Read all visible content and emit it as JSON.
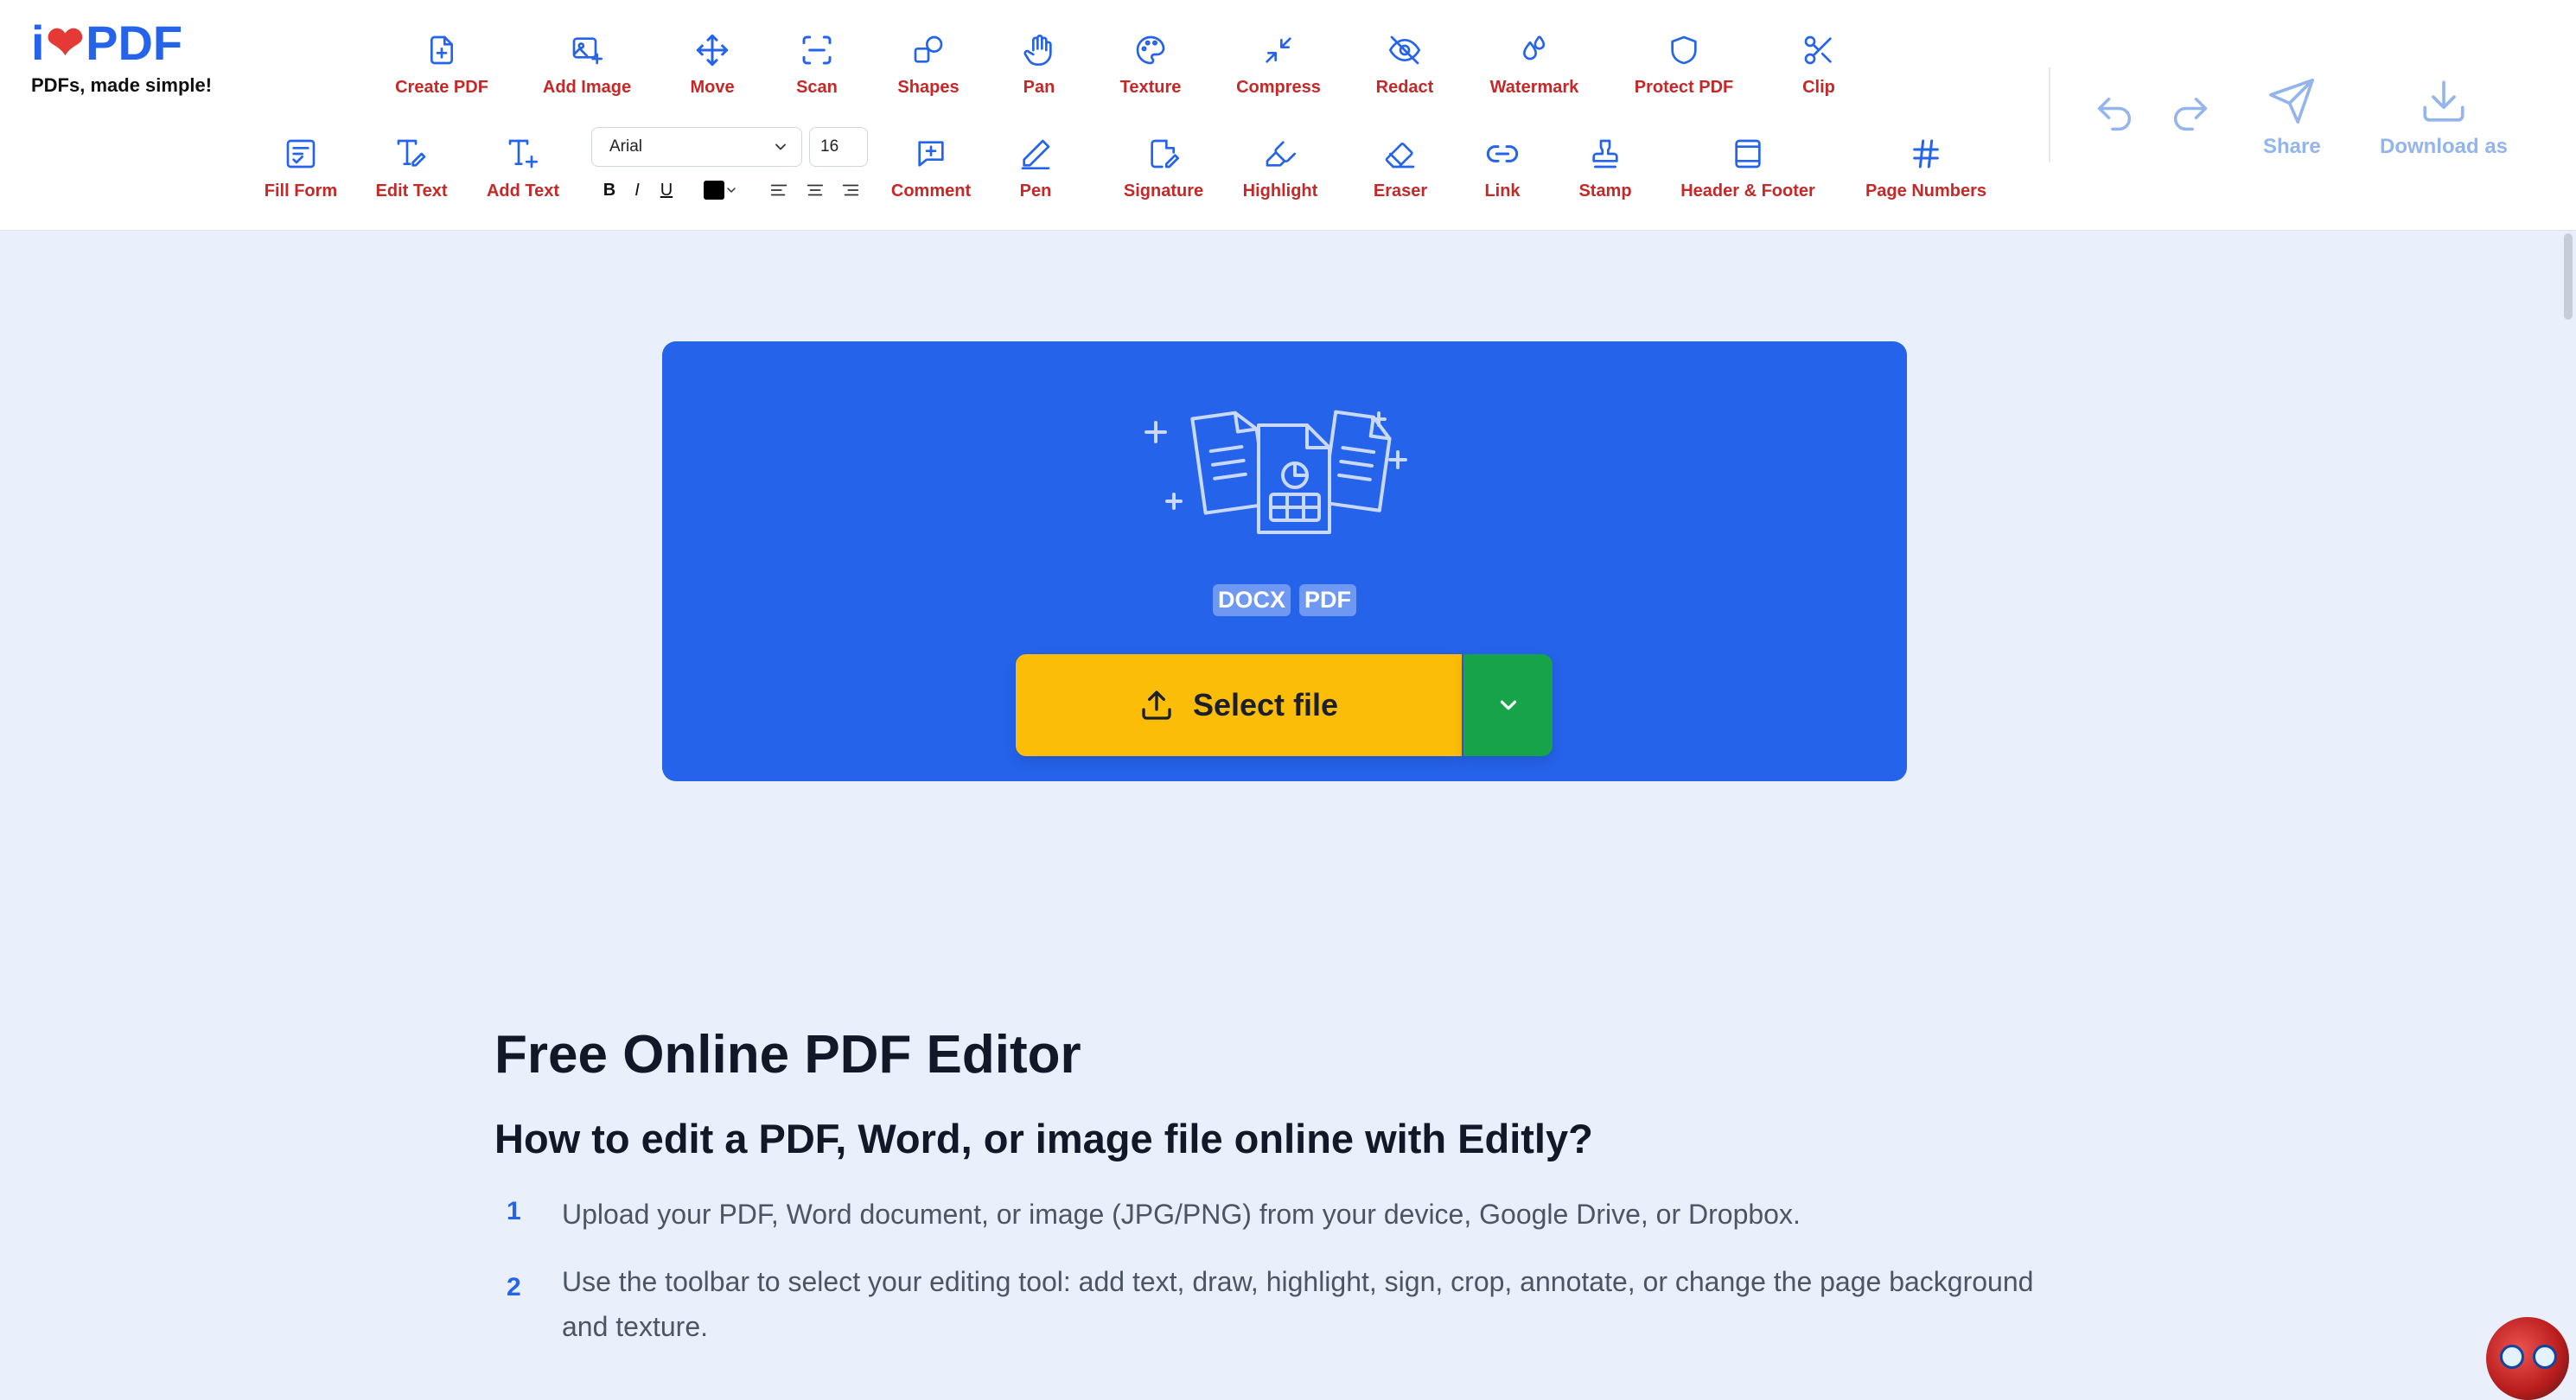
{
  "logo": {
    "prefix": "i",
    "suffix": "PDF",
    "tagline": "PDFs, made simple!"
  },
  "toolbar": {
    "row1": [
      {
        "label": "Create PDF",
        "icon": "file-plus-icon"
      },
      {
        "label": "Add Image",
        "icon": "image-plus-icon"
      },
      {
        "label": "Move",
        "icon": "move-arrows-icon"
      },
      {
        "label": "Scan",
        "icon": "scan-icon"
      },
      {
        "label": "Shapes",
        "icon": "shapes-icon"
      },
      {
        "label": "Pan",
        "icon": "hand-icon"
      },
      {
        "label": "Texture",
        "icon": "palette-icon"
      },
      {
        "label": "Compress",
        "icon": "compress-icon"
      },
      {
        "label": "Redact",
        "icon": "eye-off-icon"
      },
      {
        "label": "Watermark",
        "icon": "droplets-icon"
      },
      {
        "label": "Protect PDF",
        "icon": "shield-icon"
      },
      {
        "label": "Clip",
        "icon": "scissors-icon"
      }
    ],
    "row2": [
      {
        "label": "Fill Form",
        "icon": "form-icon"
      },
      {
        "label": "Edit Text",
        "icon": "edit-text-icon"
      },
      {
        "label": "Add Text",
        "icon": "add-text-icon"
      },
      {
        "label": "Comment",
        "icon": "comment-icon"
      },
      {
        "label": "Pen",
        "icon": "pen-icon"
      },
      {
        "label": "Signature",
        "icon": "signature-icon"
      },
      {
        "label": "Highlight",
        "icon": "highlighter-icon"
      },
      {
        "label": "Eraser",
        "icon": "eraser-icon"
      },
      {
        "label": "Link",
        "icon": "link-icon"
      },
      {
        "label": "Stamp",
        "icon": "stamp-icon"
      },
      {
        "label": "Header & Footer",
        "icon": "header-footer-icon"
      },
      {
        "label": "Page Numbers",
        "icon": "hash-icon"
      }
    ],
    "font": {
      "family": "Arial",
      "size": "16"
    },
    "format": {
      "bold": "B",
      "italic": "I",
      "underline": "U",
      "color": "#000000"
    },
    "right": {
      "share": "Share",
      "download": "Download as"
    }
  },
  "hero": {
    "badges": [
      "DOCX",
      "PDF"
    ],
    "select_label": "Select file",
    "bg_color": "#2563eb",
    "button_color": "#fbbd08",
    "dropdown_color": "#16a34a"
  },
  "content": {
    "title": "Free Online PDF Editor",
    "subtitle": "How to edit a PDF, Word, or image file online with Editly?",
    "steps": [
      {
        "num": "1",
        "text": "Upload your PDF, Word document, or image (JPG/PNG) from your device, Google Drive, or Dropbox."
      },
      {
        "num": "2",
        "text": "Use the toolbar to select your editing tool: add text, draw, highlight, sign, crop, annotate, or change the page background and texture."
      }
    ]
  }
}
